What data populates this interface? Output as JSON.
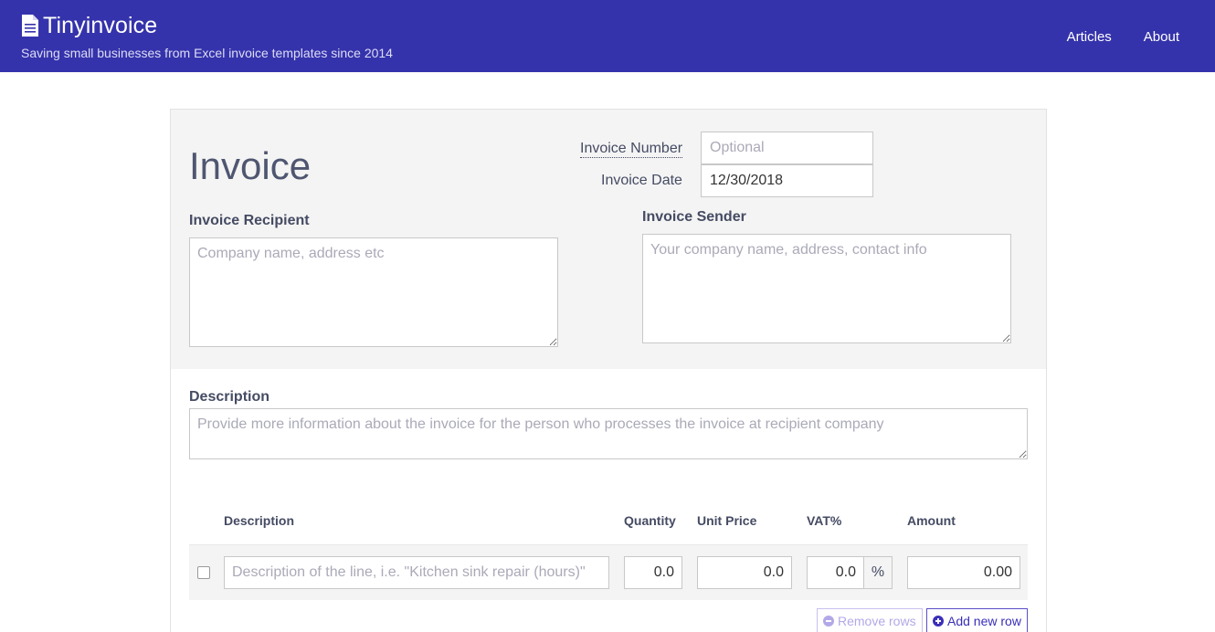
{
  "header": {
    "brand": "Tinyinvoice",
    "tagline": "Saving small businesses from Excel invoice templates since 2014",
    "nav": {
      "articles": "Articles",
      "about": "About"
    },
    "colors": {
      "bar": "#3533ab"
    }
  },
  "invoice": {
    "title": "Invoice",
    "number_label": "Invoice Number",
    "number_placeholder": "Optional",
    "number_value": "",
    "date_label": "Invoice Date",
    "date_value": "12/30/2018",
    "recipient_label": "Invoice Recipient",
    "recipient_placeholder": "Company name, address etc",
    "sender_label": "Invoice Sender",
    "sender_placeholder": "Your company name, address, contact info",
    "description_label": "Description",
    "description_placeholder": "Provide more information about the invoice for the person who processes the invoice at recipient company"
  },
  "table": {
    "headers": {
      "description": "Description",
      "quantity": "Quantity",
      "unit_price": "Unit Price",
      "vat": "VAT%",
      "amount": "Amount"
    },
    "rows": [
      {
        "checked": false,
        "description_placeholder": "Description of the line, i.e. \"Kitchen sink repair (hours)\"",
        "quantity": "0.0",
        "unit_price": "0.0",
        "vat": "0.0",
        "vat_suffix": "%",
        "amount": "0.00"
      }
    ],
    "buttons": {
      "remove": "Remove rows",
      "add": "Add new row"
    }
  }
}
